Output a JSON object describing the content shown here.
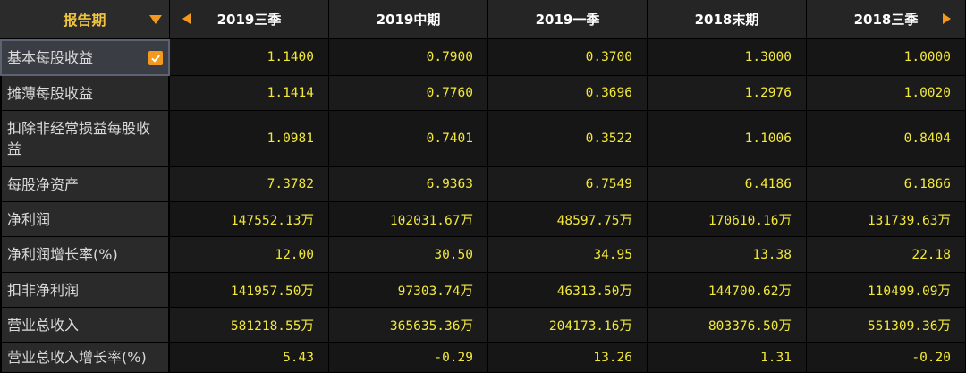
{
  "header": {
    "period_label": "报告期",
    "columns": [
      "2019三季",
      "2019中期",
      "2019一季",
      "2018末期",
      "2018三季"
    ]
  },
  "rows": [
    {
      "label": "基本每股收益",
      "values": [
        "1.1400",
        "0.7900",
        "0.3700",
        "1.3000",
        "1.0000"
      ],
      "checked": true
    },
    {
      "label": "摊薄每股收益",
      "values": [
        "1.1414",
        "0.7760",
        "0.3696",
        "1.2976",
        "1.0020"
      ]
    },
    {
      "label": "扣除非经常损益每股收益",
      "values": [
        "1.0981",
        "0.7401",
        "0.3522",
        "1.1006",
        "0.8404"
      ]
    },
    {
      "label": "每股净资产",
      "values": [
        "7.3782",
        "6.9363",
        "6.7549",
        "6.4186",
        "6.1866"
      ]
    },
    {
      "label": "净利润",
      "values": [
        "147552.13万",
        "102031.67万",
        "48597.75万",
        "170610.16万",
        "131739.63万"
      ]
    },
    {
      "label": "净利润增长率(%)",
      "values": [
        "12.00",
        "30.50",
        "34.95",
        "13.38",
        "22.18"
      ]
    },
    {
      "label": "扣非净利润",
      "values": [
        "141957.50万",
        "97303.74万",
        "46313.50万",
        "144700.62万",
        "110499.09万"
      ]
    },
    {
      "label": "营业总收入",
      "values": [
        "581218.55万",
        "365635.36万",
        "204173.16万",
        "803376.50万",
        "551309.36万"
      ]
    },
    {
      "label": "营业总收入增长率(%)",
      "values": [
        "5.43",
        "-0.29",
        "13.26",
        "1.31",
        "-0.20"
      ]
    }
  ],
  "colors": {
    "background": "#000000",
    "label_text": "#d9d9d9",
    "value_text": "#f2e83a",
    "accent": "#f39a1e",
    "header_period_text": "#f0c43c"
  },
  "icons": {
    "prev": "triangle-left-icon",
    "next": "triangle-right-icon",
    "dropdown": "caret-down-icon",
    "check": "checkbox-checked-icon"
  }
}
